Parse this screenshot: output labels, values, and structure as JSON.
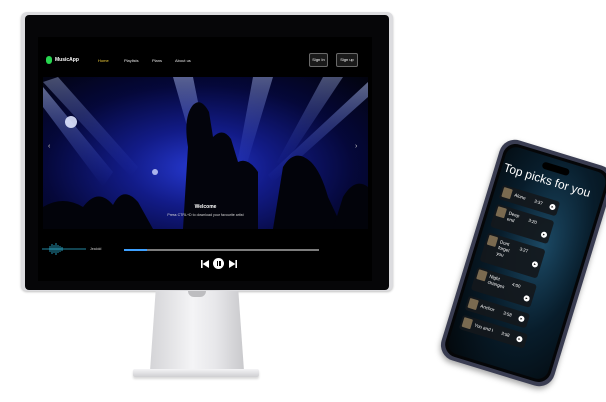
{
  "desktop": {
    "app_name": "MusicApp",
    "nav": [
      {
        "label": "Home",
        "active": true
      },
      {
        "label": "Playlists",
        "active": false
      },
      {
        "label": "Plans",
        "active": false
      },
      {
        "label": "About us",
        "active": false
      }
    ],
    "buttons": {
      "sign_in": "Sign In",
      "sign_up": "Sign up"
    },
    "hero": {
      "title": "Welcome",
      "subtitle": "Press CTRL+D to download your favourite artist"
    },
    "player": {
      "track": "Jealold",
      "progress_fraction": 0.12,
      "controls": [
        "previous-icon",
        "pause-icon",
        "next-icon"
      ]
    },
    "accent_color": "#27d64f",
    "active_nav_color": "#f3d03a"
  },
  "mobile": {
    "heading": "Top picks for you",
    "tracks": [
      {
        "title": "Alone",
        "duration": "3:37"
      },
      {
        "title": "Deep\nend",
        "duration": "3:20"
      },
      {
        "title": "Dont\nforget\nyou",
        "duration": "3:27"
      },
      {
        "title": "Night\nchanges",
        "duration": "4:00"
      },
      {
        "title": "Anchor",
        "duration": "3:58"
      },
      {
        "title": "You and I",
        "duration": "3:58"
      }
    ]
  }
}
